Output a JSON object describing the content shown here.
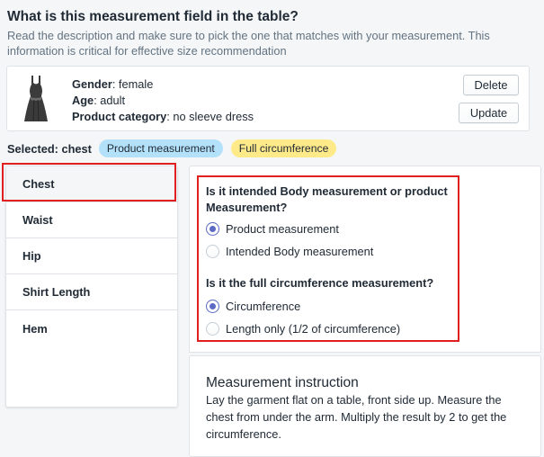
{
  "header": {
    "title": "What is this measurement field in the table?",
    "description": "Read the description and make sure to pick the one that matches with your measurement. This information is critical for effective size recommendation"
  },
  "product": {
    "icon": "dress-icon",
    "gender_label": "Gender",
    "gender_value": ": female",
    "age_label": "Age",
    "age_value": ": adult",
    "category_label": "Product category",
    "category_value": ": no sleeve dress",
    "delete_label": "Delete",
    "update_label": "Update"
  },
  "selected": {
    "label": "Selected: chest",
    "badges": [
      "Product measurement",
      "Full circumference"
    ],
    "badge_colors": [
      "#b4e1fa",
      "#ffea8a"
    ]
  },
  "measurements": {
    "items": [
      "Chest",
      "Waist",
      "Hip",
      "Shirt Length",
      "Hem"
    ],
    "active_index": 0
  },
  "questions": [
    {
      "text": "Is it intended Body measurement or product Measurement?",
      "options": [
        "Product measurement",
        "Intended Body measurement"
      ],
      "selected": 0
    },
    {
      "text": "Is it the full circumference measurement?",
      "options": [
        "Circumference",
        "Length only (1/2 of circumference)"
      ],
      "selected": 0
    }
  ],
  "instruction": {
    "title": "Measurement instruction",
    "body": "Lay the garment flat on a table, front side up. Measure the chest from under the arm. Multiply the result by 2 to get the circumference."
  },
  "colors": {
    "highlight": "#e02020",
    "radio_accent": "#5c6ac4"
  }
}
